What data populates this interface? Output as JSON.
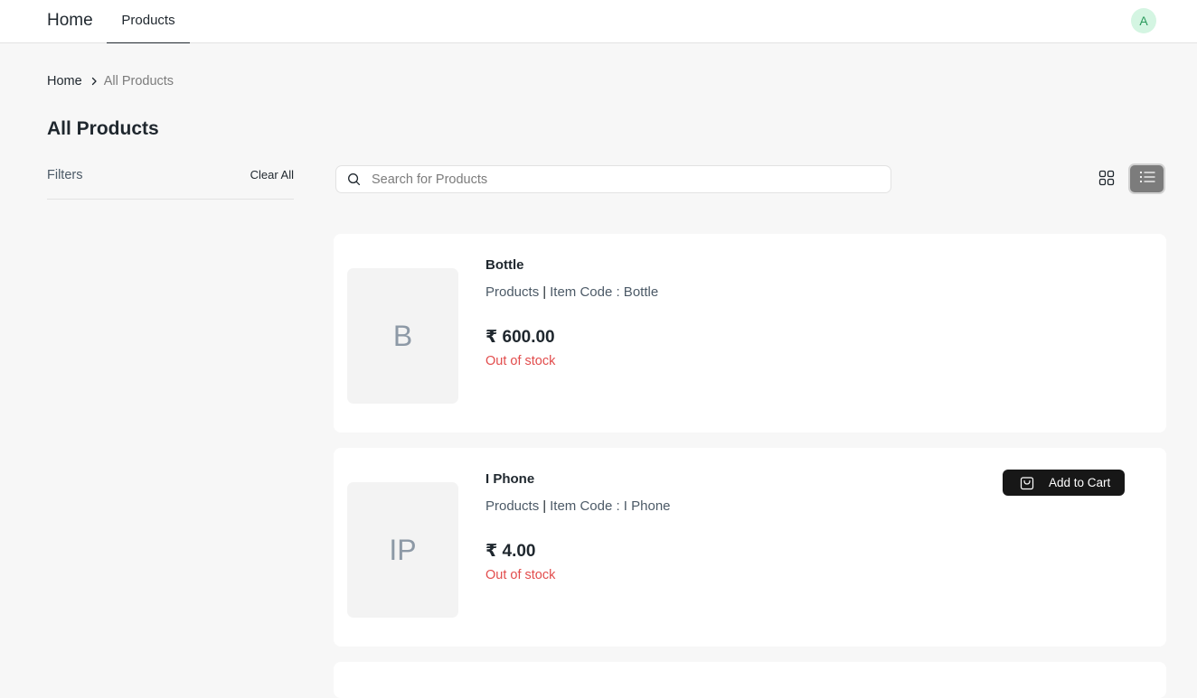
{
  "navbar": {
    "brand": "Home",
    "tab_products": "Products",
    "avatar_initial": "A"
  },
  "breadcrumb": {
    "home": "Home",
    "current": "All Products"
  },
  "page": {
    "title": "All Products"
  },
  "filters": {
    "label": "Filters",
    "clear_all": "Clear All"
  },
  "search": {
    "placeholder": "Search for Products",
    "value": ""
  },
  "view_toggle": {
    "active": "list"
  },
  "products": [
    {
      "initials": "B",
      "name": "Bottle",
      "group": "Products",
      "item_code_label": "Item Code : Bottle",
      "price": "₹ 600.00",
      "stock": "Out of stock",
      "add_to_cart": ""
    },
    {
      "initials": "IP",
      "name": "I Phone",
      "group": "Products",
      "item_code_label": "Item Code : I Phone",
      "price": "₹ 4.00",
      "stock": "Out of stock",
      "add_to_cart": "Add to Cart"
    }
  ],
  "colors": {
    "background": "#f7f7f7",
    "out_of_stock": "#e24c4c",
    "button_dark": "#171717",
    "avatar_bg": "#d4f5e2",
    "avatar_text": "#2a9a5c"
  }
}
